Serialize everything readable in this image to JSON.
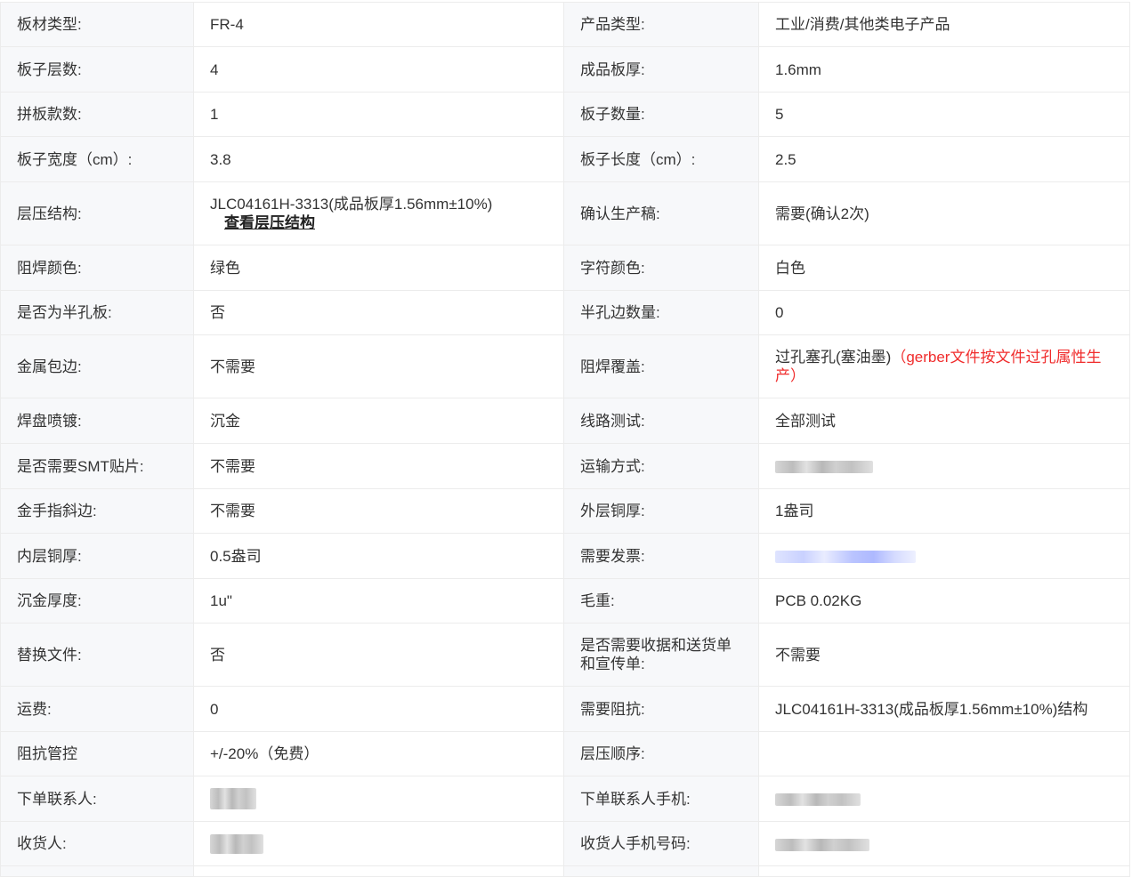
{
  "rows": [
    {
      "l1": "板材类型:",
      "v1": "FR-4",
      "l2": "产品类型:",
      "v2": "工业/消费/其他类电子产品"
    },
    {
      "l1": "板子层数:",
      "v1": "4",
      "l2": "成品板厚:",
      "v2": "1.6mm"
    },
    {
      "l1": "拼板款数:",
      "v1": "1",
      "l2": "板子数量:",
      "v2": "5"
    },
    {
      "l1": "板子宽度（cm）:",
      "v1": "3.8",
      "l2": "板子长度（cm）:",
      "v2": "2.5"
    },
    {
      "l1": "层压结构:",
      "v1": "JLC04161H-3313(成品板厚1.56mm±10%)",
      "v1_link": "查看层压结构",
      "l2": "确认生产稿:",
      "v2": "需要(确认2次)"
    },
    {
      "l1": "阻焊颜色:",
      "v1": "绿色",
      "l2": "字符颜色:",
      "v2": "白色"
    },
    {
      "l1": "是否为半孔板:",
      "v1": "否",
      "l2": "半孔边数量:",
      "v2": "0"
    },
    {
      "l1": "金属包边:",
      "v1": "不需要",
      "l2": "阻焊覆盖:",
      "v2": "过孔塞孔(塞油墨)",
      "v2_note": "（gerber文件按文件过孔属性生产）"
    },
    {
      "l1": "焊盘喷镀:",
      "v1": "沉金",
      "l2": "线路测试:",
      "v2": "全部测试"
    },
    {
      "l1": "是否需要SMT贴片:",
      "v1": "不需要",
      "l2": "运输方式:",
      "v2": ""
    },
    {
      "l1": "金手指斜边:",
      "v1": "不需要",
      "l2": "外层铜厚:",
      "v2": "1盎司"
    },
    {
      "l1": "内层铜厚:",
      "v1": "0.5盎司",
      "l2": "需要发票:",
      "v2": ""
    },
    {
      "l1": "沉金厚度:",
      "v1": "1u\"",
      "l2": "毛重:",
      "v2": "PCB 0.02KG"
    },
    {
      "l1": "替换文件:",
      "v1": "否",
      "l2": "是否需要收据和送货单和宣传单:",
      "v2": "不需要"
    },
    {
      "l1": "运费:",
      "v1": "0",
      "l2": "需要阻抗:",
      "v2": "JLC04161H-3313(成品板厚1.56mm±10%)结构"
    },
    {
      "l1": "阻抗管控",
      "v1": "+/-20%（免费）",
      "l2": "层压顺序:",
      "v2": ""
    },
    {
      "l1": "下单联系人:",
      "v1": "",
      "l2": "下单联系人手机:",
      "v2": ""
    },
    {
      "l1": "收货人:",
      "v1": "",
      "l2": "收货人手机号码:",
      "v2": ""
    },
    {
      "l1": "",
      "v1": "",
      "l2": "",
      "v2": ""
    }
  ],
  "colors": {
    "red_note": "#f02c2c",
    "label_bg": "#f7f8fa",
    "border": "#ececec"
  }
}
